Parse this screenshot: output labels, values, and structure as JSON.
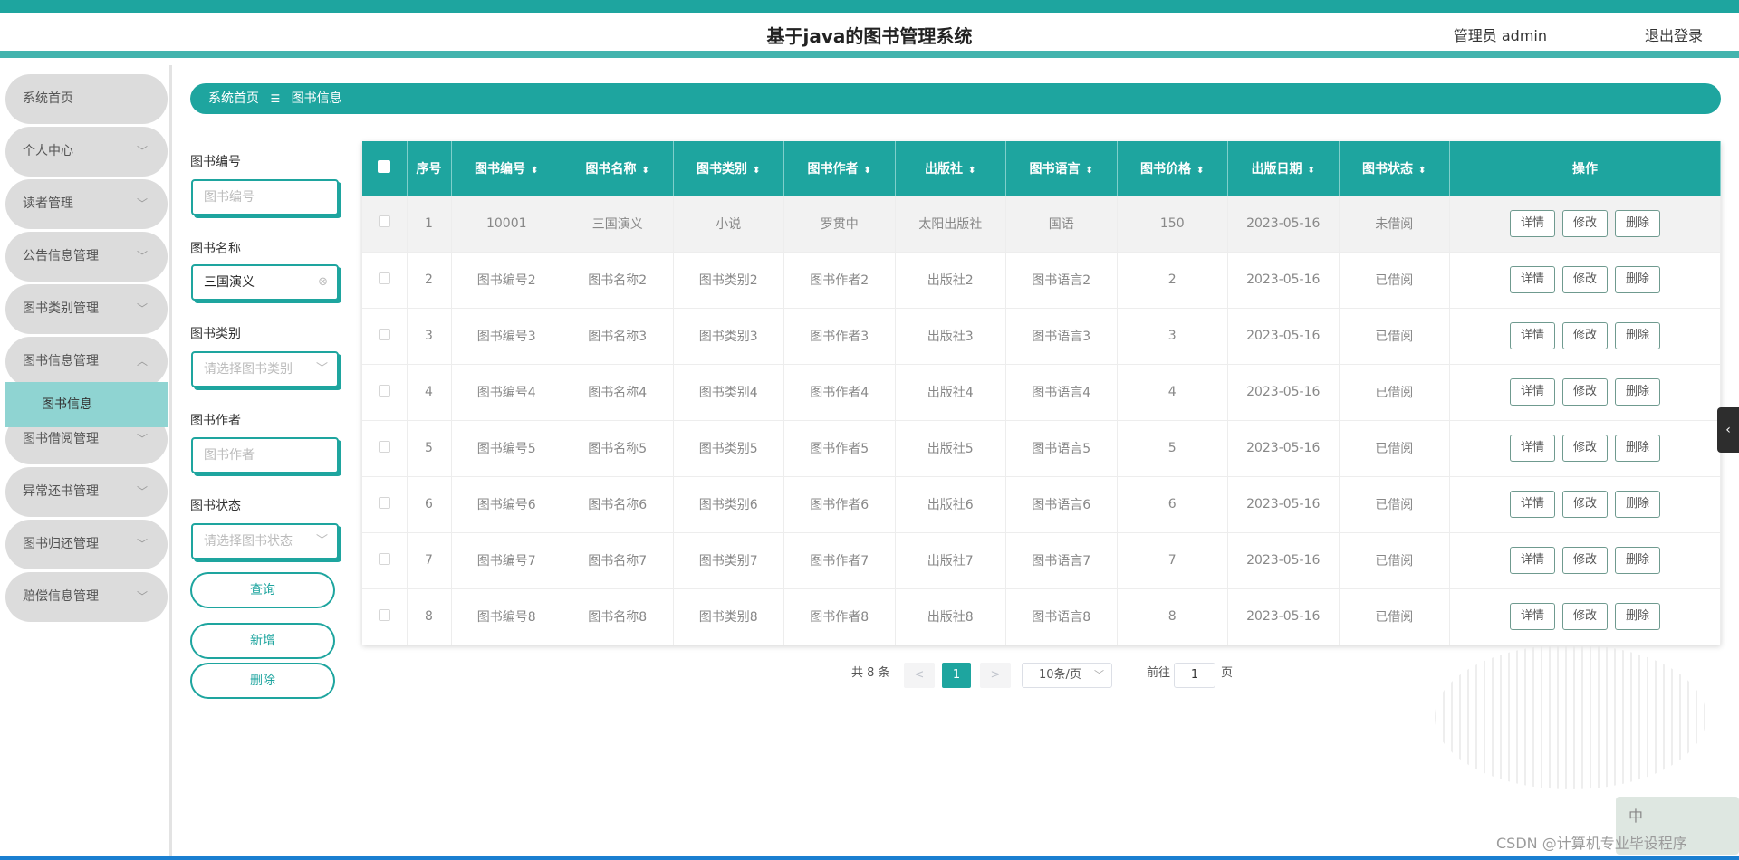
{
  "header": {
    "title": "基于java的图书管理系统",
    "admin_label": "管理员 admin",
    "logout_label": "退出登录"
  },
  "sidebar": {
    "items": [
      {
        "label": "系统首页",
        "chevron": ""
      },
      {
        "label": "个人中心",
        "chevron": "﹀"
      },
      {
        "label": "读者管理",
        "chevron": "﹀"
      },
      {
        "label": "公告信息管理",
        "chevron": "﹀"
      },
      {
        "label": "图书类别管理",
        "chevron": "﹀"
      },
      {
        "label": "图书信息管理",
        "chevron": "︿"
      },
      {
        "label": "图书借阅管理",
        "chevron": "﹀"
      },
      {
        "label": "异常还书管理",
        "chevron": "﹀"
      },
      {
        "label": "图书归还管理",
        "chevron": "﹀"
      },
      {
        "label": "赔偿信息管理",
        "chevron": "﹀"
      }
    ],
    "active_subitem": "图书信息"
  },
  "breadcrumb": {
    "home": "系统首页",
    "separator": "☰",
    "current": "图书信息"
  },
  "search": {
    "fields": [
      {
        "label": "图书编号",
        "placeholder": "图书编号",
        "value": ""
      },
      {
        "label": "图书名称",
        "placeholder": "",
        "value": "三国演义"
      },
      {
        "label": "图书类别",
        "placeholder": "请选择图书类别",
        "value": ""
      },
      {
        "label": "图书作者",
        "placeholder": "图书作者",
        "value": ""
      },
      {
        "label": "图书状态",
        "placeholder": "请选择图书状态",
        "value": ""
      }
    ],
    "query_label": "查询",
    "add_label": "新增",
    "delete_label": "删除"
  },
  "table": {
    "headers": [
      "序号",
      "图书编号",
      "图书名称",
      "图书类别",
      "图书作者",
      "出版社",
      "图书语言",
      "图书价格",
      "出版日期",
      "图书状态",
      "操作"
    ],
    "rows": [
      [
        "1",
        "10001",
        "三国演义",
        "小说",
        "罗贯中",
        "太阳出版社",
        "国语",
        "150",
        "2023-05-16",
        "未借阅"
      ],
      [
        "2",
        "图书编号2",
        "图书名称2",
        "图书类别2",
        "图书作者2",
        "出版社2",
        "图书语言2",
        "2",
        "2023-05-16",
        "已借阅"
      ],
      [
        "3",
        "图书编号3",
        "图书名称3",
        "图书类别3",
        "图书作者3",
        "出版社3",
        "图书语言3",
        "3",
        "2023-05-16",
        "已借阅"
      ],
      [
        "4",
        "图书编号4",
        "图书名称4",
        "图书类别4",
        "图书作者4",
        "出版社4",
        "图书语言4",
        "4",
        "2023-05-16",
        "已借阅"
      ],
      [
        "5",
        "图书编号5",
        "图书名称5",
        "图书类别5",
        "图书作者5",
        "出版社5",
        "图书语言5",
        "5",
        "2023-05-16",
        "已借阅"
      ],
      [
        "6",
        "图书编号6",
        "图书名称6",
        "图书类别6",
        "图书作者6",
        "出版社6",
        "图书语言6",
        "6",
        "2023-05-16",
        "已借阅"
      ],
      [
        "7",
        "图书编号7",
        "图书名称7",
        "图书类别7",
        "图书作者7",
        "出版社7",
        "图书语言7",
        "7",
        "2023-05-16",
        "已借阅"
      ],
      [
        "8",
        "图书编号8",
        "图书名称8",
        "图书类别8",
        "图书作者8",
        "出版社8",
        "图书语言8",
        "8",
        "2023-05-16",
        "已借阅"
      ]
    ],
    "row_actions": [
      "详情",
      "修改",
      "删除"
    ]
  },
  "pagination": {
    "total": "共 8 条",
    "prev": "<",
    "current": "1",
    "next": ">",
    "page_size": "10条/页",
    "goto_prefix": "前往",
    "goto_value": "1",
    "goto_suffix": "页"
  },
  "side_tab": {
    "icon": "‹"
  },
  "watermark": "CSDN @计算机专业毕设程序",
  "ime_badge": "中",
  "colors": {
    "accent": "#1ea59f",
    "accent_light": "#8fd4d2"
  }
}
